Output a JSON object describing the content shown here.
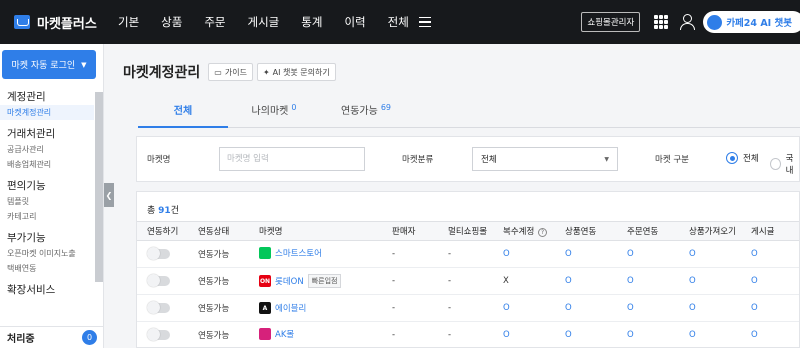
{
  "app": {
    "name": "마켓플러스"
  },
  "nav": [
    "기본",
    "상품",
    "주문",
    "게시글",
    "통계",
    "이력",
    "전체"
  ],
  "top_right": {
    "admin_button": "쇼핑몰관리자",
    "ai_chip": "카페24 AI 챗봇"
  },
  "sidebar": {
    "login_button": "마켓 자동 로그인",
    "groups": [
      {
        "title": "계정관리",
        "items": [
          "마켓계정관리"
        ]
      },
      {
        "title": "거래처관리",
        "items": [
          "공급사관리",
          "배송업체관리"
        ]
      },
      {
        "title": "편의기능",
        "items": [
          "템플릿",
          "카테고리"
        ]
      },
      {
        "title": "부가기능",
        "items": [
          "오픈마켓 이미지노출",
          "택배연동"
        ]
      },
      {
        "title": "확장서비스",
        "items": []
      }
    ],
    "processing": {
      "label": "처리중",
      "count": "0"
    }
  },
  "page": {
    "title": "마켓계정관리",
    "guide_button": "가이드",
    "ai_button": "AI 챗봇 문의하기"
  },
  "tabs": [
    {
      "label": "전체",
      "count": ""
    },
    {
      "label": "나의마켓",
      "count": "0"
    },
    {
      "label": "연동가능",
      "count": "69"
    }
  ],
  "filter": {
    "market_name_label": "마켓명",
    "market_name_placeholder": "마켓명 입력",
    "category_label": "마켓분류",
    "category_value": "전체",
    "type_label": "마켓 구분",
    "radio_all": "전체",
    "radio_domestic": "국내"
  },
  "table": {
    "total_prefix": "총",
    "total_count": "91",
    "total_suffix": "건",
    "headers": [
      "연동하기",
      "연동상태",
      "마켓명",
      "판매자",
      "멀티쇼핑몰",
      "복수계정",
      "상품연동",
      "주문연동",
      "상품가져오기",
      "게시글"
    ],
    "rows": [
      {
        "status": "연동가능",
        "market": "스마트스토어",
        "icon": "smartstore-icon",
        "icon_color": "#03c75a",
        "badge": "",
        "seller": "-",
        "multi": "-",
        "multi_account": "O",
        "product": "O",
        "order": "O",
        "import": "O",
        "board": "O"
      },
      {
        "status": "연동가능",
        "market": "롯데ON",
        "icon": "lotteon-icon",
        "icon_color": "#e60012",
        "badge": "빠른입점",
        "seller": "-",
        "multi": "-",
        "multi_account": "X",
        "product": "O",
        "order": "O",
        "import": "O",
        "board": "O"
      },
      {
        "status": "연동가능",
        "market": "에이블리",
        "icon": "ably-icon",
        "icon_color": "#111111",
        "badge": "",
        "seller": "-",
        "multi": "-",
        "multi_account": "O",
        "product": "O",
        "order": "O",
        "import": "O",
        "board": "O"
      },
      {
        "status": "연동가능",
        "market": "AK몰",
        "icon": "akmall-icon",
        "icon_color": "#d6217b",
        "badge": "",
        "seller": "-",
        "multi": "-",
        "multi_account": "O",
        "product": "O",
        "order": "O",
        "import": "O",
        "board": "O"
      }
    ]
  },
  "colors": {
    "accent": "#2f7ee8",
    "topbar": "#17191c"
  }
}
